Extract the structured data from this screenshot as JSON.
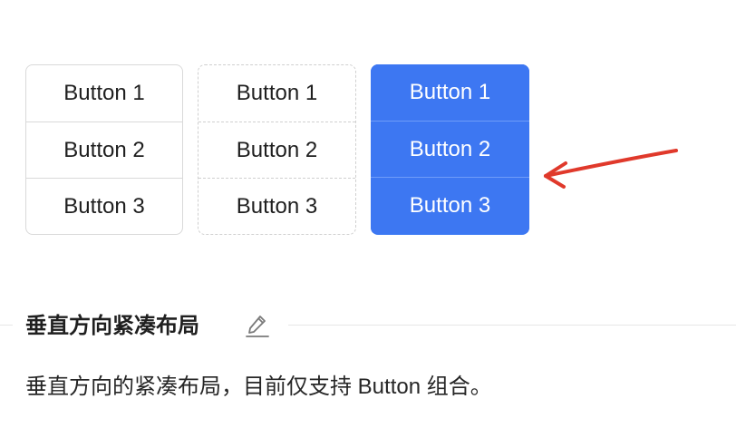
{
  "groups": {
    "default": {
      "buttons": [
        "Button 1",
        "Button 2",
        "Button 3"
      ]
    },
    "dashed": {
      "buttons": [
        "Button 1",
        "Button 2",
        "Button 3"
      ]
    },
    "primary": {
      "buttons": [
        "Button 1",
        "Button 2",
        "Button 3"
      ]
    }
  },
  "section": {
    "title": "垂直方向紧凑布局",
    "description": "垂直方向的紧凑布局，目前仅支持 Button 组合。"
  },
  "colors": {
    "primary": "#3d77f2",
    "annotation_arrow": "#e0392b",
    "border": "#d9d9d9"
  },
  "icons": {
    "edit": "pencil-edit-icon",
    "annotation": "arrow-annotation"
  }
}
